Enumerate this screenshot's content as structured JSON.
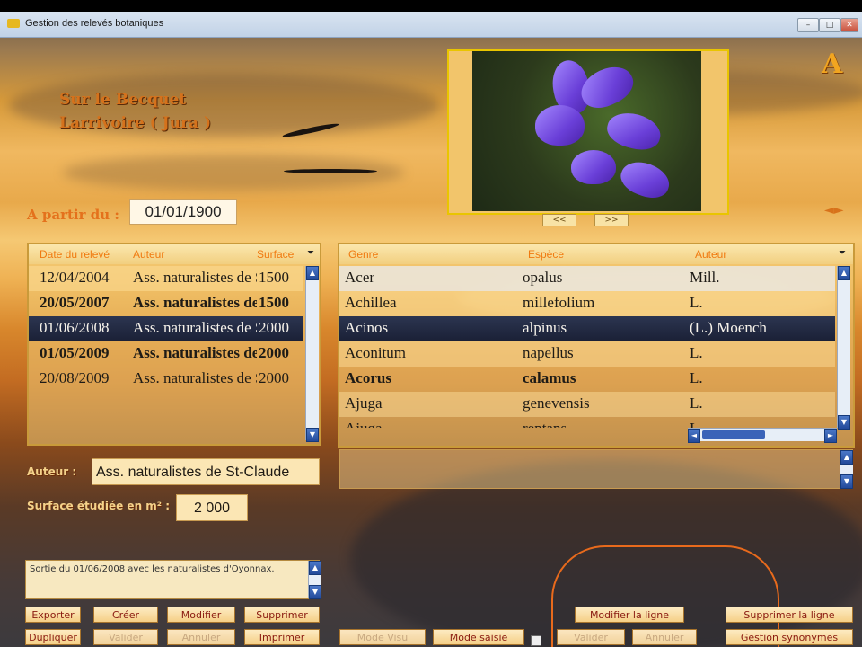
{
  "window": {
    "title": "Gestion des relevés botaniques"
  },
  "location": {
    "line1": "Sur le Becquet",
    "line2": "Larrivoire ( Jura )"
  },
  "logo": "A",
  "photo_nav": {
    "prev": "<<",
    "next": ">>"
  },
  "date_filter": {
    "label": "A partir du :",
    "value": "01/01/1900",
    "arrows": "◄►"
  },
  "releves": {
    "columns": [
      "Date du relevé",
      "Auteur",
      "Surface"
    ],
    "rows": [
      {
        "date": "12/04/2004",
        "auteur": "Ass. naturalistes de St-Claude",
        "surface": "1500"
      },
      {
        "date": "20/05/2007",
        "auteur": "Ass. naturalistes de St-Claude",
        "surface": "1500"
      },
      {
        "date": "01/06/2008",
        "auteur": "Ass. naturalistes de St-Claude",
        "surface": "2000"
      },
      {
        "date": "01/05/2009",
        "auteur": "Ass. naturalistes de St-Claude",
        "surface": "2000"
      },
      {
        "date": "20/08/2009",
        "auteur": "Ass. naturalistes de St-Claude",
        "surface": "2000"
      }
    ]
  },
  "especes": {
    "columns": [
      "Genre",
      "Espèce",
      "Auteur"
    ],
    "rows": [
      {
        "genre": "Acer",
        "espece": "opalus",
        "auteur": "Mill."
      },
      {
        "genre": "Achillea",
        "espece": "millefolium",
        "auteur": "L."
      },
      {
        "genre": "Acinos",
        "espece": "alpinus",
        "auteur": "(L.) Moench"
      },
      {
        "genre": "Aconitum",
        "espece": "napellus",
        "auteur": "L."
      },
      {
        "genre": "Acorus",
        "espece": "calamus",
        "auteur": "L."
      },
      {
        "genre": "Ajuga",
        "espece": "genevensis",
        "auteur": "L."
      },
      {
        "genre": "Ajuga",
        "espece": "reptans",
        "auteur": "L."
      }
    ]
  },
  "auteur": {
    "label": "Auteur :",
    "value": "Ass. naturalistes de St-Claude"
  },
  "surface": {
    "label": "Surface étudiée en m² :",
    "value": "2 000"
  },
  "note": "Sortie du 01/06/2008 avec les naturalistes d'Oyonnax.",
  "buttons": {
    "exporter": "Exporter",
    "creer": "Créer",
    "modifier": "Modifier",
    "supprimer": "Supprimer",
    "dupliquer": "Dupliquer",
    "valider": "Valider",
    "annuler": "Annuler",
    "imprimer": "Imprimer",
    "mode_visu": "Mode Visu",
    "mode_saisie": "Mode saisie",
    "modifier_ligne": "Modifier la ligne",
    "valider2": "Valider",
    "annuler2": "Annuler",
    "supprimer_ligne": "Supprimer la ligne",
    "gestion_synonymes": "Gestion synonymes"
  },
  "colors": {
    "accent": "#e4711c",
    "selection": "#1a2036",
    "button_text": "#8a1a10"
  }
}
